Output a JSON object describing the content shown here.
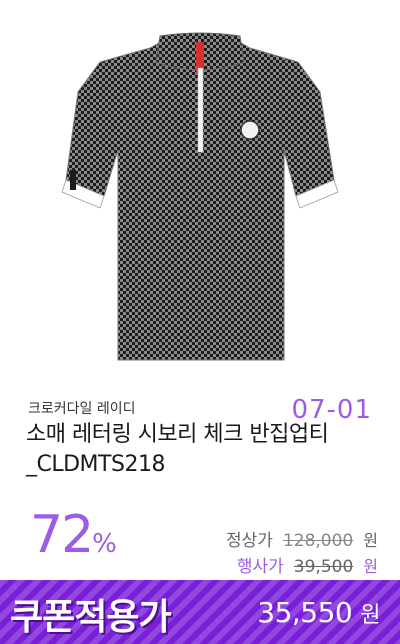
{
  "product": {
    "image_alt": "check pattern short sleeve zip-up polo shirt",
    "sleeve_text": "LADIES"
  },
  "event_date": "07-01",
  "brand": "크로커다일 레이디",
  "title": "소매 레터링 시보리 체크 반집업티 _CLDMTS218",
  "discount": {
    "value": "72",
    "unit": "%"
  },
  "prices": {
    "normal_label": "정상가",
    "normal_value": "128,000",
    "normal_unit": "원",
    "event_label": "행사가",
    "event_value": "39,500",
    "event_unit": "원"
  },
  "coupon": {
    "label": "쿠폰적용가",
    "value": "35,550",
    "unit": "원"
  },
  "colors": {
    "accent": "#9b5de5",
    "coupon_bg": "#7a1fd8",
    "zip_tab": "#d83030"
  }
}
